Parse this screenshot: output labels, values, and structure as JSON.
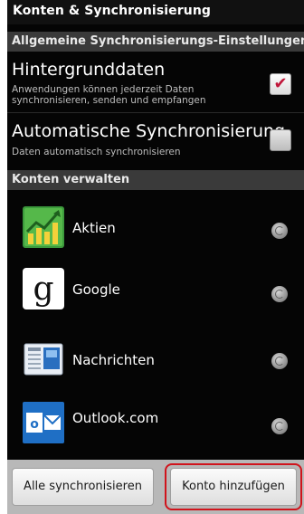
{
  "title_bar": {
    "title": "Konten & Synchronisierung"
  },
  "general": {
    "header": "Allgemeine Synchronisierungs-Einstellungen",
    "background_data": {
      "title": "Hintergrunddaten",
      "description": "Anwendungen können jederzeit Daten synchronisieren, senden und empfangen",
      "checked": true
    },
    "auto_sync": {
      "title": "Automatische Synchronisierung",
      "description": "Daten automatisch synchronisieren",
      "checked": false
    }
  },
  "accounts": {
    "header": "Konten verwalten",
    "items": [
      {
        "label": "Aktien",
        "icon": "stocks-chart-icon",
        "color": "#2e8b2e"
      },
      {
        "label": "Google",
        "icon": "google-g-icon",
        "color": "#1a1a1a"
      },
      {
        "label": "Nachrichten",
        "icon": "news-icon",
        "color": "#2a6fbf"
      },
      {
        "label": "Outlook.com",
        "icon": "outlook-icon",
        "color": "#1f6fc5"
      }
    ]
  },
  "bottom_bar": {
    "sync_all_label": "Alle synchronisieren",
    "add_account_label": "Konto hinzufügen",
    "highlight_color": "#d0141c"
  }
}
